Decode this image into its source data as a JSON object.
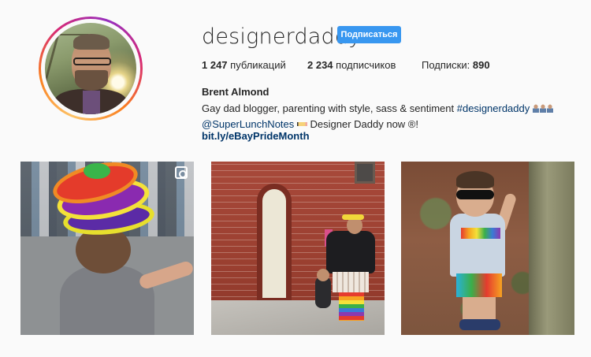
{
  "profile": {
    "username": "designerdaddy",
    "follow_label": "Подписаться",
    "full_name": "Brent Almond",
    "stats": {
      "posts_count": "1 247",
      "posts_label": "публикаций",
      "followers_count": "2 234",
      "followers_label": "подписчиков",
      "following_label": "Подписки:",
      "following_count": "890"
    },
    "bio": {
      "line1_text": "Gay dad blogger, parenting with style, sass & sentiment ",
      "line1_hashtag": "#designerdaddy",
      "line2_mention": "@SuperLunchNotes",
      "line2_text": " Designer Daddy now ®!",
      "link": "bit.ly/eBayPrideMonth"
    }
  },
  "icons": {
    "post1_overlay": "camera-icon",
    "bio_emoji_1": "family-emoji-icon",
    "bio_emoji_2": "pencil-emoji-icon"
  },
  "colors": {
    "accent": "#3897f0",
    "link": "#003569",
    "text": "#262626",
    "background": "#fafafa"
  }
}
